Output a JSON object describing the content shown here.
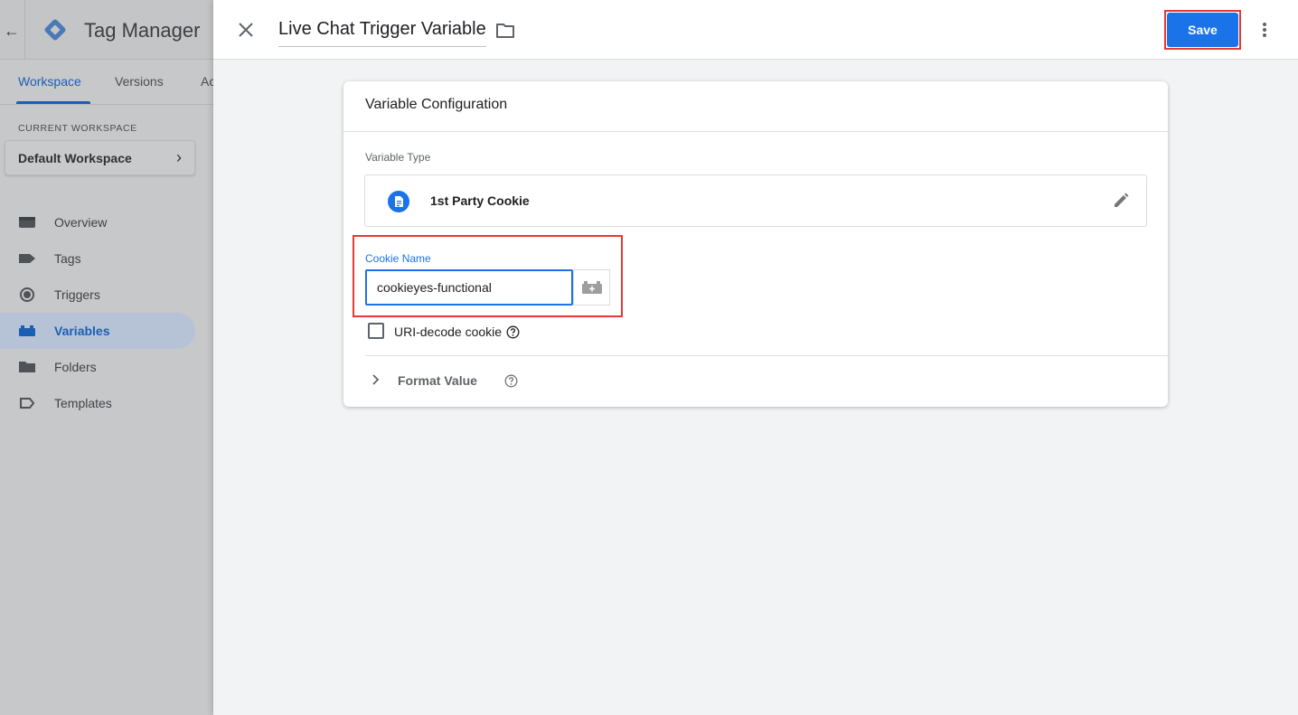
{
  "sidebar": {
    "app_name": "Tag Manager",
    "tabs": [
      {
        "label": "Workspace",
        "active": true
      },
      {
        "label": "Versions",
        "active": false
      },
      {
        "label": "Ac",
        "active": false
      }
    ],
    "workspace_section_label": "CURRENT WORKSPACE",
    "workspace_name": "Default Workspace",
    "nav": [
      {
        "label": "Overview",
        "icon": "overview-icon",
        "active": false
      },
      {
        "label": "Tags",
        "icon": "tag-icon",
        "active": false
      },
      {
        "label": "Triggers",
        "icon": "trigger-icon",
        "active": false
      },
      {
        "label": "Variables",
        "icon": "variables-icon",
        "active": true
      },
      {
        "label": "Folders",
        "icon": "folder-icon",
        "active": false
      },
      {
        "label": "Templates",
        "icon": "template-icon",
        "active": false
      }
    ]
  },
  "panel": {
    "title": "Live Chat Trigger Variable",
    "save_label": "Save"
  },
  "config": {
    "card_title": "Variable Configuration",
    "variable_type_label": "Variable Type",
    "variable_type_name": "1st Party Cookie",
    "cookie_name_label": "Cookie Name",
    "cookie_name_value": "cookieyes-functional",
    "uri_decode_label": "URI-decode cookie",
    "uri_decode_checked": false,
    "format_value_label": "Format Value"
  },
  "colors": {
    "accent": "#1a73e8",
    "highlight": "#e53935"
  }
}
